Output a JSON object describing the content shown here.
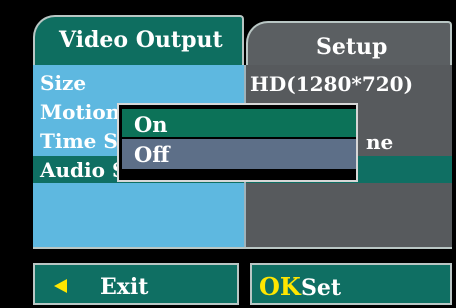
{
  "tabs": [
    {
      "label": "Video Output"
    },
    {
      "label": "Setup"
    }
  ],
  "menu_items": [
    {
      "label": "Size",
      "value": "HD(1280*720)"
    },
    {
      "label": "Motion",
      "value": ""
    },
    {
      "label": "Time S",
      "value": "ne"
    },
    {
      "label": "Audio S",
      "value": ""
    }
  ],
  "popup": {
    "options": [
      "On",
      "Off"
    ],
    "selected": "On"
  },
  "footer": {
    "exit_label": "Exit",
    "ok_label": "OK",
    "set_label": "Set"
  },
  "colors": {
    "active_tab": "#0e6e60",
    "highlight": "#0f6f63",
    "left_pane": "#5eb8e0",
    "right_pane": "#575a5d",
    "accent_yellow": "#ffe600"
  }
}
